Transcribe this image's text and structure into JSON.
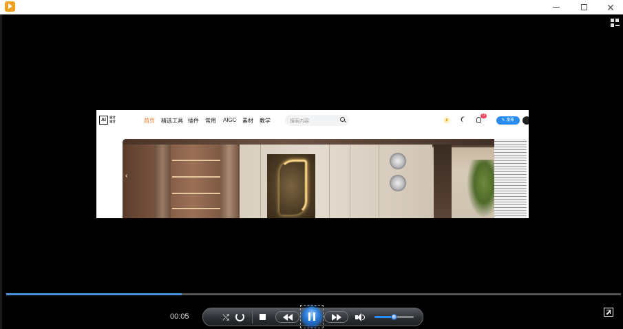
{
  "window": {
    "app_icon": "media-player-icon",
    "minimize_icon": "minimize-icon",
    "maximize_icon": "maximize-icon",
    "close_icon": "close-icon",
    "close_glyph": "✕"
  },
  "video": {
    "site": {
      "logo_text": "AI",
      "logo_sub_line1": "设计",
      "logo_sub_line2": "设计",
      "nav": [
        "首页",
        "精选工具",
        "插件",
        "常用",
        "AIGC",
        "素材",
        "教学"
      ],
      "active_nav": "首页",
      "search_placeholder": "搜索内容",
      "notification_count": "11",
      "publish_label": "发布",
      "hero_prev_arrow": "‹"
    }
  },
  "player": {
    "elapsed_time": "00:05",
    "progress_fraction": 0.285,
    "volume_fraction": 0.5,
    "accent_color": "#4a90d9",
    "shuffle_glyph": "⤭"
  }
}
